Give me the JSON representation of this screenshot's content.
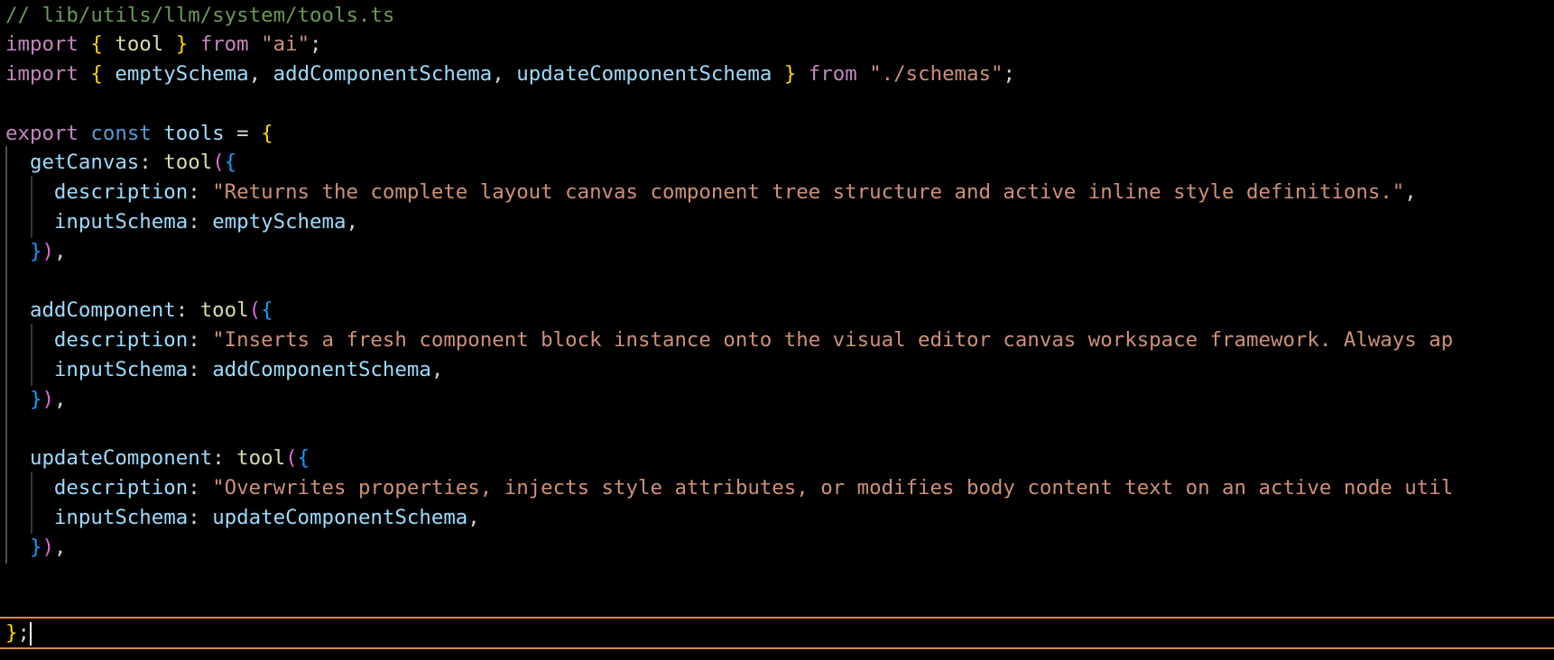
{
  "editor": {
    "comment": "// lib/utils/llm/system/tools.ts",
    "import1": {
      "keyword": "import",
      "open": "{",
      "name": "tool",
      "close": "}",
      "from": "from",
      "source": "\"ai\"",
      "end": ";"
    },
    "import2": {
      "keyword": "import",
      "open": "{",
      "names": [
        "emptySchema",
        "addComponentSchema",
        "updateComponentSchema"
      ],
      "comma": ",",
      "close": "}",
      "from": "from",
      "source": "\"./schemas\"",
      "end": ";"
    },
    "export_line": {
      "export": "export",
      "const": "const",
      "name": "tools",
      "eq": "=",
      "open": "{"
    },
    "tools": [
      {
        "key": "getCanvas",
        "fn": "tool",
        "description_key": "description",
        "description": "\"Returns the complete layout canvas component tree structure and active inline style definitions.\"",
        "schema_key": "inputSchema",
        "schema": "emptySchema"
      },
      {
        "key": "addComponent",
        "fn": "tool",
        "description_key": "description",
        "description": "\"Inserts a fresh component block instance onto the visual editor canvas workspace framework. Always ap",
        "schema_key": "inputSchema",
        "schema": "addComponentSchema"
      },
      {
        "key": "updateComponent",
        "fn": "tool",
        "description_key": "description",
        "description": "\"Overwrites properties, injects style attributes, or modifies body content text on an active node util",
        "schema_key": "inputSchema",
        "schema": "updateComponentSchema"
      }
    ],
    "punct": {
      "colon": ":",
      "comma": ",",
      "paren_open": "(",
      "paren_close": ")",
      "brace_open": "{",
      "brace_close": "}",
      "semicolon": ";"
    }
  },
  "colors": {
    "background": "#000000",
    "comment": "#6a9955",
    "keyword": "#c586c0",
    "storage": "#569cd6",
    "variable": "#9cdcfe",
    "function": "#dcdcaa",
    "string": "#ce9178",
    "bracket_1": "#ffd700",
    "bracket_2": "#da70d6",
    "bracket_3": "#179fff",
    "current_line_border": "#d98a3a"
  }
}
